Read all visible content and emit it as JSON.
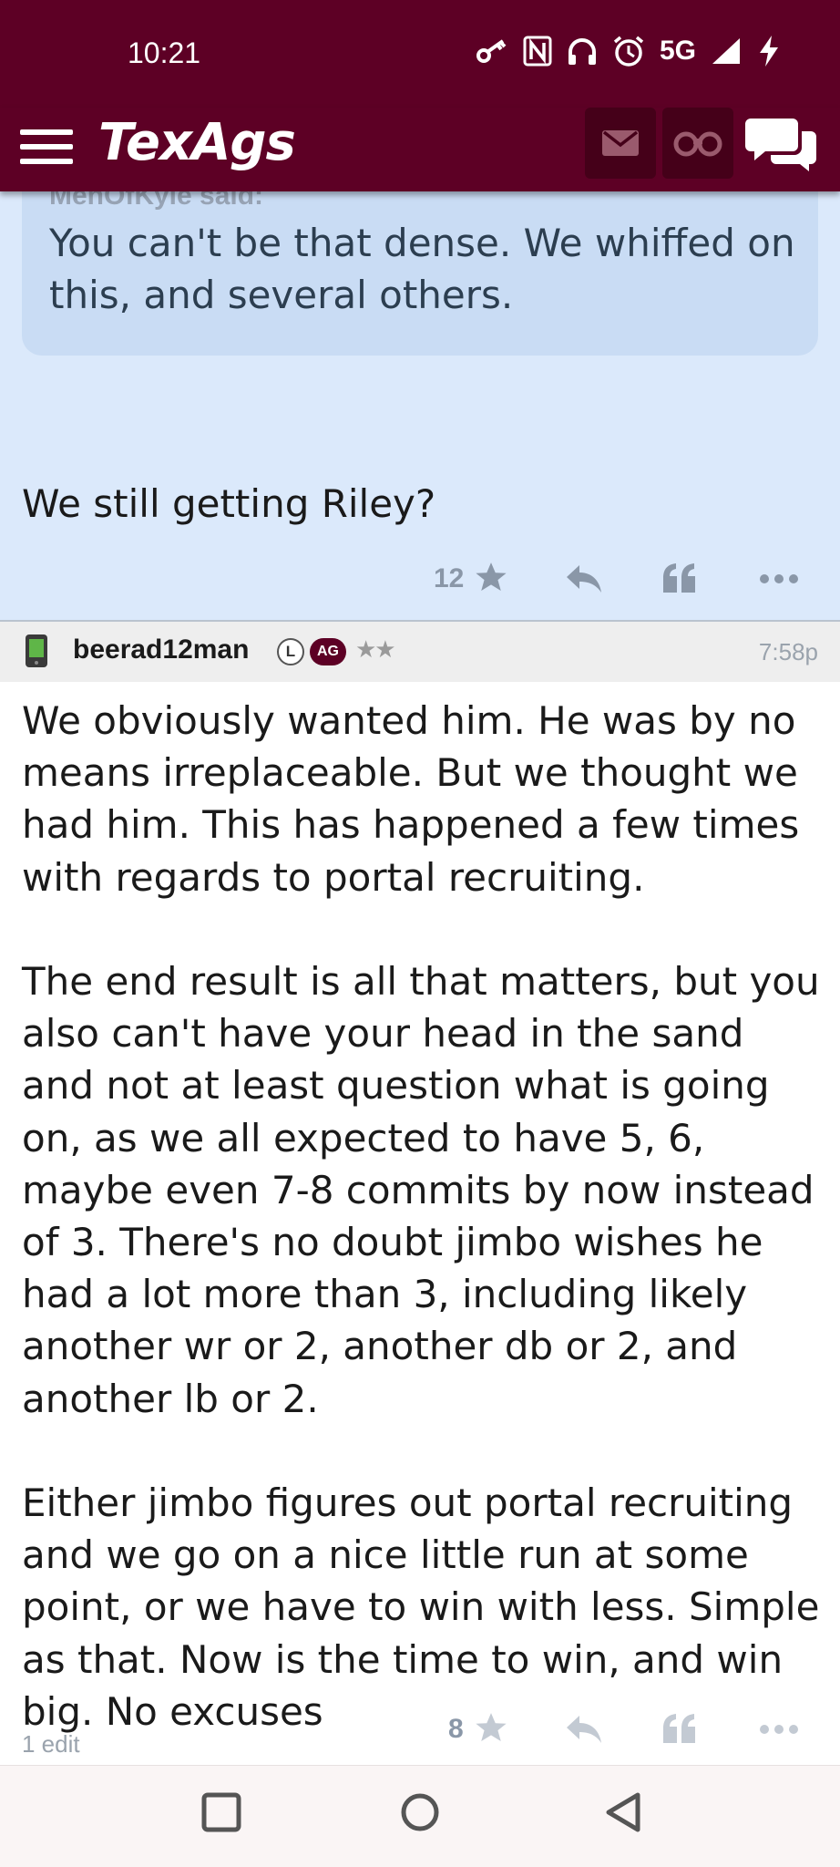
{
  "status_bar": {
    "time": "10:21",
    "network": "5G",
    "icons": [
      "key-icon",
      "nfc-icon",
      "headphones-icon",
      "alarm-icon",
      "signal-icon",
      "charging-icon"
    ]
  },
  "header": {
    "logo": "TexAgs",
    "icons": [
      "menu-icon",
      "mail-icon",
      "binoculars-icon",
      "chat-icon"
    ]
  },
  "colors": {
    "maroon": "#5d0025",
    "quote_bg": "#dbe9fb",
    "action_gray": "#8a97a8"
  },
  "previous_post": {
    "quote": {
      "author": "MenOfKyle said:",
      "text": "You can't be that dense. We whiffed on this, and several others."
    },
    "body": "We still getting Riley?",
    "stars": "12"
  },
  "post": {
    "username": "beerad12man",
    "badge_l": "L",
    "badge_ag": "AG",
    "rank": "★★",
    "time": "7:58p",
    "paragraphs": [
      "We obviously wanted him. He was by no means irreplaceable. But we thought we had him. This has happened a few times with regards to portal recruiting.",
      "The end result is all that matters, but you also can't have your head in the sand and not at least question what is going on, as we all expected to have 5, 6, maybe even 7-8 commits by now instead of 3. There's no doubt jimbo wishes he had a lot more than 3, including likely another wr or 2, another db or 2, and another lb or 2.",
      "Either jimbo figures out portal recruiting and we go on a nice little run at some point, or we have to win with less. Simple as that. Now is the time to win, and win big. No excuses"
    ],
    "edit_note": "1 edit",
    "stars": "8"
  }
}
